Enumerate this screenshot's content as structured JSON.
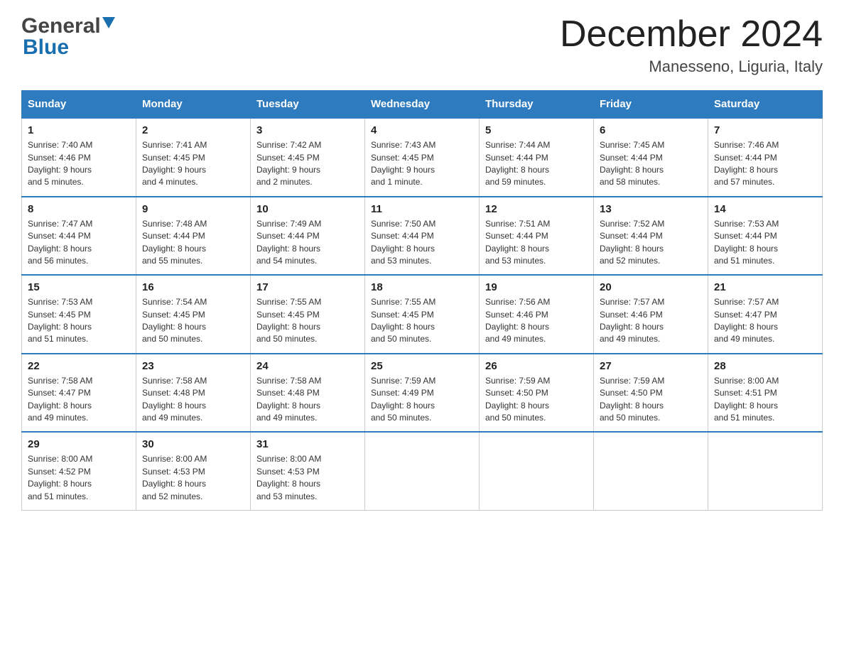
{
  "header": {
    "logo_line1": "General",
    "logo_line2": "Blue",
    "month_title": "December 2024",
    "location": "Manesseno, Liguria, Italy"
  },
  "days_of_week": [
    "Sunday",
    "Monday",
    "Tuesday",
    "Wednesday",
    "Thursday",
    "Friday",
    "Saturday"
  ],
  "weeks": [
    [
      {
        "num": "1",
        "sunrise": "7:40 AM",
        "sunset": "4:46 PM",
        "daylight": "9 hours and 5 minutes."
      },
      {
        "num": "2",
        "sunrise": "7:41 AM",
        "sunset": "4:45 PM",
        "daylight": "9 hours and 4 minutes."
      },
      {
        "num": "3",
        "sunrise": "7:42 AM",
        "sunset": "4:45 PM",
        "daylight": "9 hours and 2 minutes."
      },
      {
        "num": "4",
        "sunrise": "7:43 AM",
        "sunset": "4:45 PM",
        "daylight": "9 hours and 1 minute."
      },
      {
        "num": "5",
        "sunrise": "7:44 AM",
        "sunset": "4:44 PM",
        "daylight": "8 hours and 59 minutes."
      },
      {
        "num": "6",
        "sunrise": "7:45 AM",
        "sunset": "4:44 PM",
        "daylight": "8 hours and 58 minutes."
      },
      {
        "num": "7",
        "sunrise": "7:46 AM",
        "sunset": "4:44 PM",
        "daylight": "8 hours and 57 minutes."
      }
    ],
    [
      {
        "num": "8",
        "sunrise": "7:47 AM",
        "sunset": "4:44 PM",
        "daylight": "8 hours and 56 minutes."
      },
      {
        "num": "9",
        "sunrise": "7:48 AM",
        "sunset": "4:44 PM",
        "daylight": "8 hours and 55 minutes."
      },
      {
        "num": "10",
        "sunrise": "7:49 AM",
        "sunset": "4:44 PM",
        "daylight": "8 hours and 54 minutes."
      },
      {
        "num": "11",
        "sunrise": "7:50 AM",
        "sunset": "4:44 PM",
        "daylight": "8 hours and 53 minutes."
      },
      {
        "num": "12",
        "sunrise": "7:51 AM",
        "sunset": "4:44 PM",
        "daylight": "8 hours and 53 minutes."
      },
      {
        "num": "13",
        "sunrise": "7:52 AM",
        "sunset": "4:44 PM",
        "daylight": "8 hours and 52 minutes."
      },
      {
        "num": "14",
        "sunrise": "7:53 AM",
        "sunset": "4:44 PM",
        "daylight": "8 hours and 51 minutes."
      }
    ],
    [
      {
        "num": "15",
        "sunrise": "7:53 AM",
        "sunset": "4:45 PM",
        "daylight": "8 hours and 51 minutes."
      },
      {
        "num": "16",
        "sunrise": "7:54 AM",
        "sunset": "4:45 PM",
        "daylight": "8 hours and 50 minutes."
      },
      {
        "num": "17",
        "sunrise": "7:55 AM",
        "sunset": "4:45 PM",
        "daylight": "8 hours and 50 minutes."
      },
      {
        "num": "18",
        "sunrise": "7:55 AM",
        "sunset": "4:45 PM",
        "daylight": "8 hours and 50 minutes."
      },
      {
        "num": "19",
        "sunrise": "7:56 AM",
        "sunset": "4:46 PM",
        "daylight": "8 hours and 49 minutes."
      },
      {
        "num": "20",
        "sunrise": "7:57 AM",
        "sunset": "4:46 PM",
        "daylight": "8 hours and 49 minutes."
      },
      {
        "num": "21",
        "sunrise": "7:57 AM",
        "sunset": "4:47 PM",
        "daylight": "8 hours and 49 minutes."
      }
    ],
    [
      {
        "num": "22",
        "sunrise": "7:58 AM",
        "sunset": "4:47 PM",
        "daylight": "8 hours and 49 minutes."
      },
      {
        "num": "23",
        "sunrise": "7:58 AM",
        "sunset": "4:48 PM",
        "daylight": "8 hours and 49 minutes."
      },
      {
        "num": "24",
        "sunrise": "7:58 AM",
        "sunset": "4:48 PM",
        "daylight": "8 hours and 49 minutes."
      },
      {
        "num": "25",
        "sunrise": "7:59 AM",
        "sunset": "4:49 PM",
        "daylight": "8 hours and 50 minutes."
      },
      {
        "num": "26",
        "sunrise": "7:59 AM",
        "sunset": "4:50 PM",
        "daylight": "8 hours and 50 minutes."
      },
      {
        "num": "27",
        "sunrise": "7:59 AM",
        "sunset": "4:50 PM",
        "daylight": "8 hours and 50 minutes."
      },
      {
        "num": "28",
        "sunrise": "8:00 AM",
        "sunset": "4:51 PM",
        "daylight": "8 hours and 51 minutes."
      }
    ],
    [
      {
        "num": "29",
        "sunrise": "8:00 AM",
        "sunset": "4:52 PM",
        "daylight": "8 hours and 51 minutes."
      },
      {
        "num": "30",
        "sunrise": "8:00 AM",
        "sunset": "4:53 PM",
        "daylight": "8 hours and 52 minutes."
      },
      {
        "num": "31",
        "sunrise": "8:00 AM",
        "sunset": "4:53 PM",
        "daylight": "8 hours and 53 minutes."
      },
      null,
      null,
      null,
      null
    ]
  ],
  "labels": {
    "sunrise": "Sunrise:",
    "sunset": "Sunset:",
    "daylight": "Daylight:"
  }
}
